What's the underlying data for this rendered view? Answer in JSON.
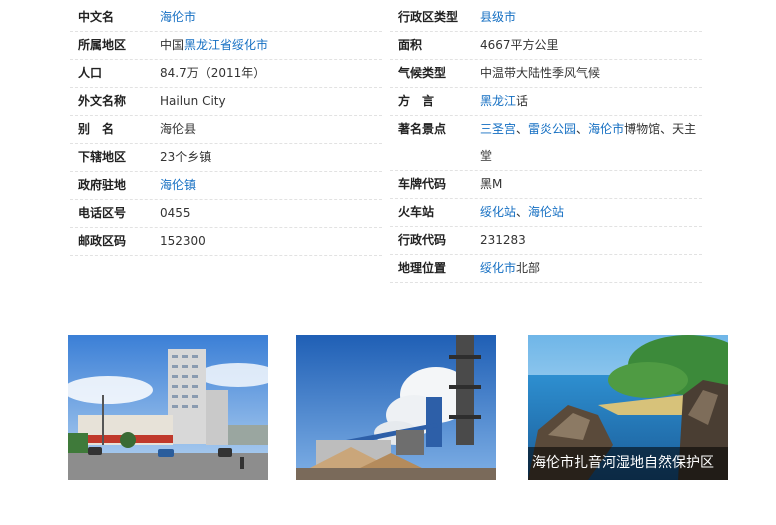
{
  "left_rows": [
    {
      "key": "中文名",
      "parts": [
        {
          "t": "海伦市",
          "link": true
        }
      ]
    },
    {
      "key": "所属地区",
      "parts": [
        {
          "t": "中国",
          "link": false
        },
        {
          "t": "黑龙江省",
          "link": true
        },
        {
          "t": "绥化市",
          "link": true
        }
      ]
    },
    {
      "key": "人口",
      "parts": [
        {
          "t": "84.7万（2011年）",
          "link": false
        }
      ]
    },
    {
      "key": "外文名称",
      "parts": [
        {
          "t": "Hailun City",
          "link": false
        }
      ]
    },
    {
      "key": "别　名",
      "parts": [
        {
          "t": "海伦县",
          "link": false
        }
      ]
    },
    {
      "key": "下辖地区",
      "parts": [
        {
          "t": "23个乡镇",
          "link": false
        }
      ]
    },
    {
      "key": "政府驻地",
      "parts": [
        {
          "t": "海伦镇",
          "link": true
        }
      ]
    },
    {
      "key": "电话区号",
      "parts": [
        {
          "t": "0455",
          "link": false
        }
      ]
    },
    {
      "key": "邮政区码",
      "parts": [
        {
          "t": "152300",
          "link": false
        }
      ]
    }
  ],
  "right_rows": [
    {
      "key": "行政区类型",
      "parts": [
        {
          "t": "县级市",
          "link": true
        }
      ]
    },
    {
      "key": "面积",
      "parts": [
        {
          "t": "4667平方公里",
          "link": false
        }
      ]
    },
    {
      "key": "气候类型",
      "parts": [
        {
          "t": "中温带大陆性季风气候",
          "link": false
        }
      ]
    },
    {
      "key": "方　言",
      "parts": [
        {
          "t": "黑龙江",
          "link": true
        },
        {
          "t": "话",
          "link": false
        }
      ]
    },
    {
      "key": "著名景点",
      "parts": [
        {
          "t": "三圣宫",
          "link": true
        },
        {
          "t": "、",
          "link": false
        },
        {
          "t": "雷炎公园",
          "link": true
        },
        {
          "t": "、",
          "link": false
        },
        {
          "t": "海伦市",
          "link": true
        },
        {
          "t": "博物馆、天主堂",
          "link": false
        }
      ]
    },
    {
      "key": "车牌代码",
      "parts": [
        {
          "t": "黑M",
          "link": false
        }
      ]
    },
    {
      "key": "火车站",
      "parts": [
        {
          "t": "绥化站",
          "link": true
        },
        {
          "t": "、",
          "link": false
        },
        {
          "t": "海伦站",
          "link": true
        }
      ]
    },
    {
      "key": "行政代码",
      "parts": [
        {
          "t": "231283",
          "link": false
        }
      ]
    },
    {
      "key": "地理位置",
      "parts": [
        {
          "t": "绥化市",
          "link": true
        },
        {
          "t": "北部",
          "link": false
        }
      ]
    }
  ],
  "photos": {
    "city_street": {
      "icon": "city-street-photo"
    },
    "factory": {
      "icon": "factory-photo"
    },
    "wetland": {
      "icon": "wetland-photo",
      "caption": "海伦市扎音河湿地自然保护区"
    }
  },
  "colors": {
    "link": "#136ec2",
    "key_text": "#222222",
    "value_text": "#333333",
    "divider": "#e2e2e2"
  }
}
